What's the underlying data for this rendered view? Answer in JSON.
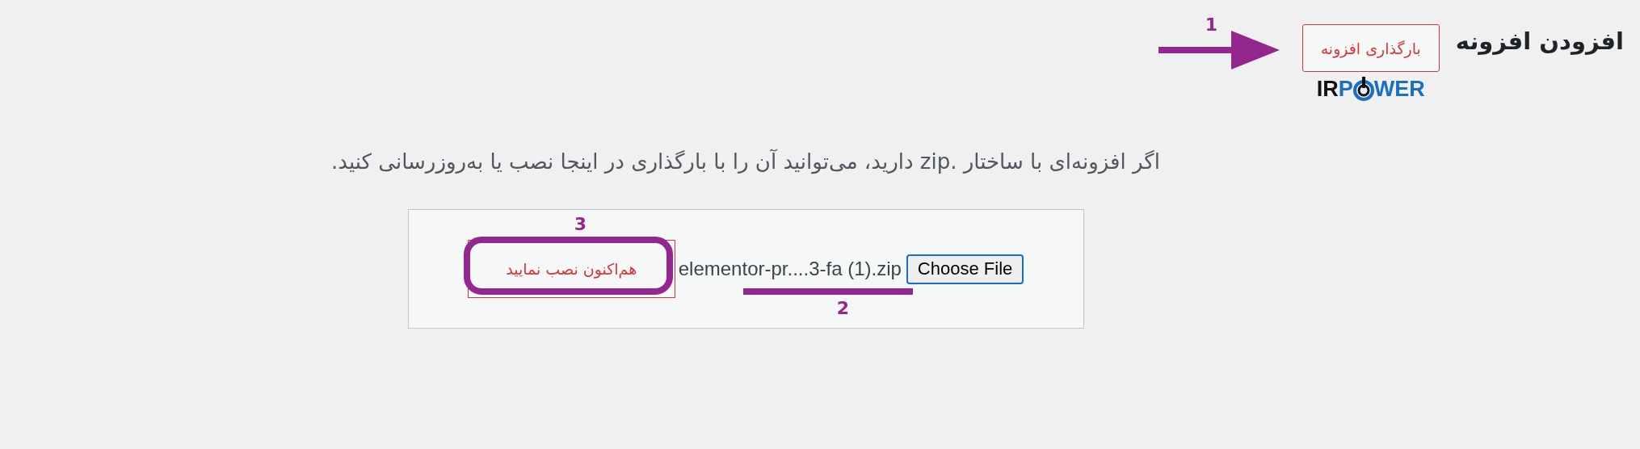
{
  "header": {
    "title": "افزودن افزونه",
    "upload_button": "بارگذاری افزونه",
    "arrow_label": "1",
    "logo": {
      "dark_part": "IR",
      "blue_start": "P",
      "blue_end": "WER"
    }
  },
  "intro": "اگر افزونه‌ای با ساختار .zip دارید، می‌توانید آن را با بارگذاری در اینجا نصب یا به‌روزرسانی کنید.",
  "upload": {
    "install_button": "هم‌اکنون نصب نمایید",
    "install_label": "3",
    "file_name": "elementor-pr....3-fa (1).zip",
    "file_label": "2",
    "choose_button": "Choose File"
  }
}
